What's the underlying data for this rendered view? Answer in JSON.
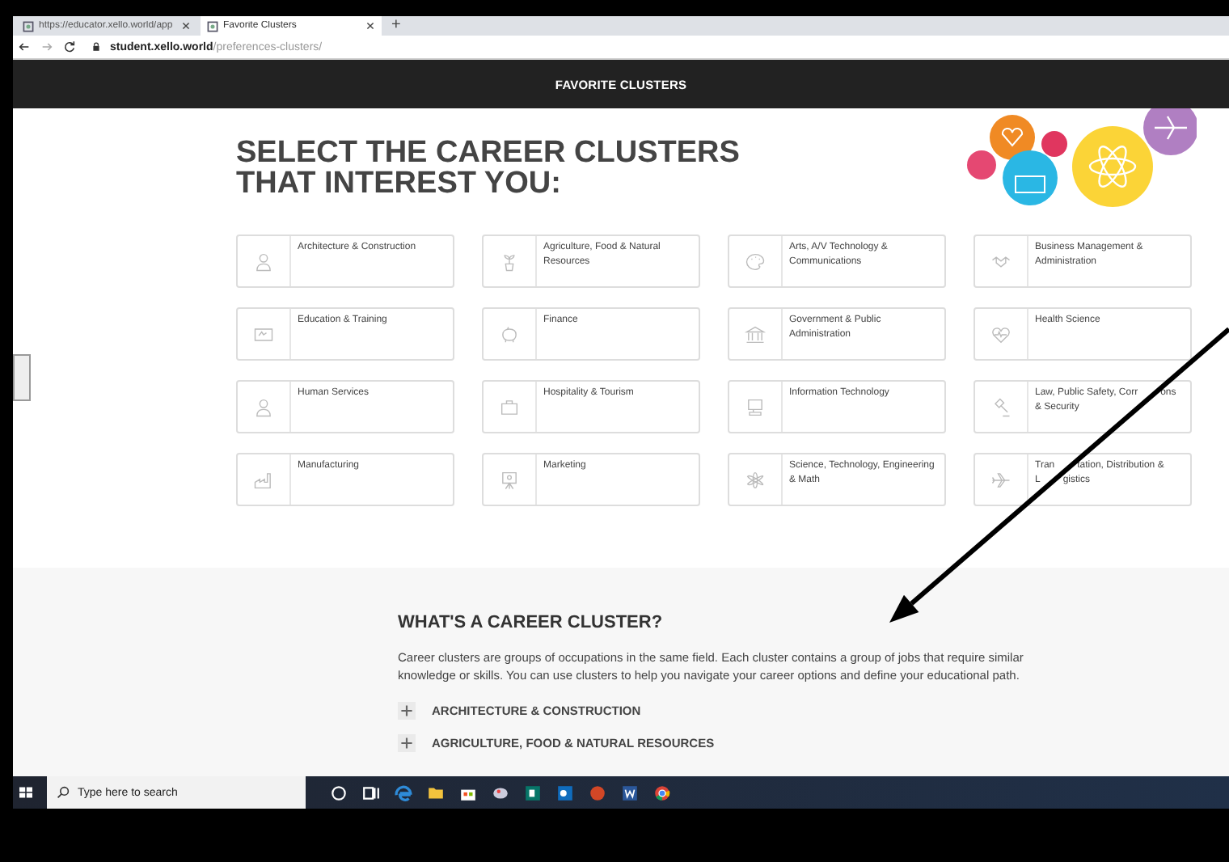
{
  "browser": {
    "tabs": [
      {
        "label": "https://educator.xello.world/app",
        "selected": false
      },
      {
        "label": "Favorite Clusters",
        "selected": true
      }
    ],
    "new_tab": "+",
    "address": {
      "host": "student.xello.world",
      "path": "/preferences-clusters/"
    }
  },
  "header": {
    "title": "FAVORITE CLUSTERS"
  },
  "heading": "SELECT THE CAREER CLUSTERS THAT INTEREST YOU:",
  "clusters": [
    {
      "label": "Architecture & Construction"
    },
    {
      "label": "Agriculture, Food & Natural Resources"
    },
    {
      "label": "Arts, A/V Technology & Communications"
    },
    {
      "label": "Business Management & Administration"
    },
    {
      "label": "Education & Training"
    },
    {
      "label": "Finance"
    },
    {
      "label": "Government & Public Administration"
    },
    {
      "label": "Health Science"
    },
    {
      "label": "Human Services"
    },
    {
      "label": "Hospitality & Tourism"
    },
    {
      "label": "Information Technology"
    },
    {
      "lines": [
        [
          "Law, Public Safety, Corr",
          "ons"
        ],
        [
          "& Security"
        ]
      ]
    },
    {
      "label": "Manufacturing"
    },
    {
      "label": "Marketing"
    },
    {
      "label": "Science, Technology, Engineering & Math"
    },
    {
      "lines": [
        [
          "Tran",
          "tation, Distribution &"
        ],
        [
          "L",
          "gistics"
        ]
      ]
    }
  ],
  "info": {
    "title": "WHAT'S A CAREER CLUSTER?",
    "text": "Career clusters are groups of occupations in the same field. Each cluster contains a group of jobs that require similar knowledge or skills. You can use clusters to help you navigate your career options and define your educational path.",
    "items": [
      {
        "label": "ARCHITECTURE & CONSTRUCTION",
        "expanded": false
      },
      {
        "label": "AGRICULTURE, FOOD & NATURAL RESOURCES",
        "expanded": false
      }
    ]
  },
  "taskbar": {
    "search": {
      "placeholder": "Type here to search"
    }
  }
}
